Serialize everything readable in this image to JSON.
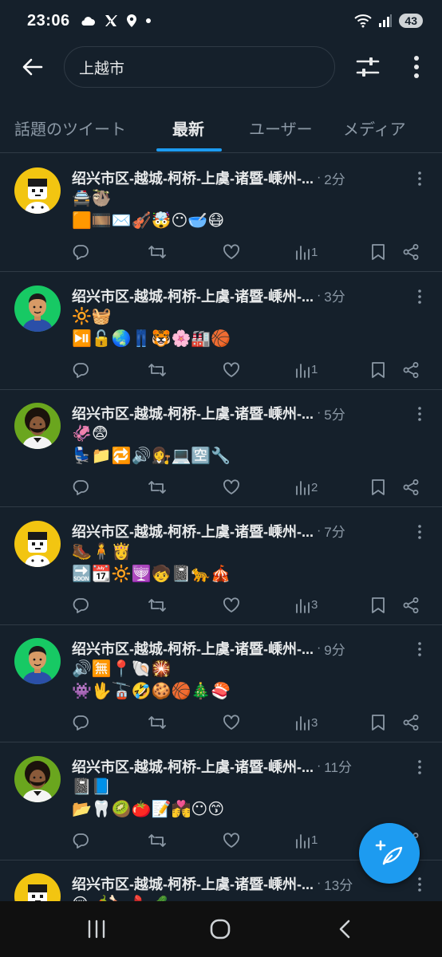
{
  "status_bar": {
    "time": "23:06",
    "left_icons": [
      "cloud-icon",
      "x-logo-icon",
      "location-icon",
      "dot-icon"
    ],
    "right_icons": [
      "wifi-icon",
      "signal-icon"
    ],
    "battery": "43"
  },
  "top_bar": {
    "search_query": "上越市"
  },
  "tabs": [
    {
      "label": "話題のツイート",
      "active": false
    },
    {
      "label": "最新",
      "active": true
    },
    {
      "label": "ユーザー",
      "active": false
    },
    {
      "label": "メディア",
      "active": false
    }
  ],
  "tweets": [
    {
      "name": "绍兴市区-越城-柯桥-上虞-诸暨-嵊州-...",
      "dot": "·",
      "time": "2分",
      "line1": "🚔🦥",
      "line2": "🟧🎞️✉️🎻🤯😶🥣😷",
      "views": "1",
      "avatar": "yellow-bot"
    },
    {
      "name": "绍兴市区-越城-柯桥-上虞-诸暨-嵊州-...",
      "dot": "·",
      "time": "3分",
      "line1": "🔆🧺",
      "line2": "⏯️🔓🌏👖🐯🌸🏭🏀",
      "views": "1",
      "avatar": "green-man"
    },
    {
      "name": "绍兴市区-越城-柯桥-上虞-诸暨-嵊州-...",
      "dot": "·",
      "time": "5分",
      "line1": "🦑😨",
      "line2": "💺📁🔁🔊👩‍⚖️💻🈳🔧",
      "views": "2",
      "avatar": "afro-man"
    },
    {
      "name": "绍兴市区-越城-柯桥-上虞-诸暨-嵊州-...",
      "dot": "·",
      "time": "7分",
      "line1": "🥾🧍👸",
      "line2": "🔜📆🔆🕎🧒📓🐆🎪",
      "views": "3",
      "avatar": "yellow-bot"
    },
    {
      "name": "绍兴市区-越城-柯桥-上虞-诸暨-嵊州-...",
      "dot": "·",
      "time": "9分",
      "line1": "🔊🈚📍🐚🎇",
      "line2": "👾🖖🚡🤣🍪🏀🎄🍣",
      "views": "3",
      "avatar": "green-man"
    },
    {
      "name": "绍兴市区-越城-柯桥-上虞-诸暨-嵊州-...",
      "dot": "·",
      "time": "11分",
      "line1": "📓📘",
      "line2": "📂🦷🥝🍅📝💏😶😙",
      "views": "1",
      "avatar": "afro-man"
    },
    {
      "name": "绍兴市区-越城-柯桥-上虞-诸暨-嵊州-...",
      "dot": "·",
      "time": "13分",
      "line1": "😢🌶️🍗💄🥒",
      "line2": "",
      "views": "",
      "avatar": "yellow-bot"
    }
  ],
  "action_icons": [
    "reply-icon",
    "retweet-icon",
    "like-icon",
    "views-icon",
    "bookmark-icon",
    "share-icon"
  ],
  "fab": {
    "icon": "compose-icon"
  },
  "nav_bar": {
    "items": [
      "recent-apps-icon",
      "home-icon",
      "back-icon"
    ]
  },
  "colors": {
    "background": "#15202b",
    "accent": "#1d9bf0",
    "muted": "#8b98a5",
    "divider": "#2f3a45"
  }
}
